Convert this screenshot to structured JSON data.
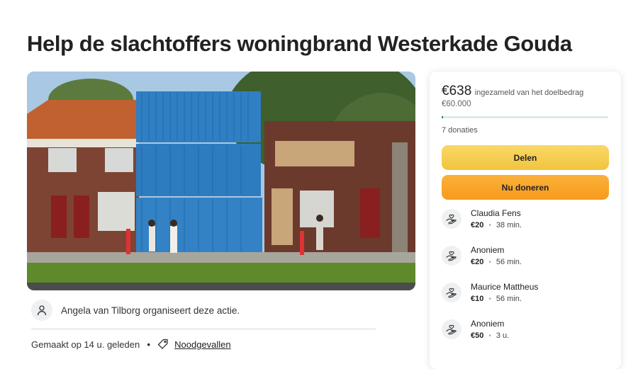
{
  "page": {
    "title": "Help de slachtoffers woningbrand Westerkade Gouda"
  },
  "hero": {
    "image_name": "containers-in-front-of-burned-houses-photo"
  },
  "organizer": {
    "text": "Angela van Tilborg organiseert deze actie.",
    "icon": "person-icon"
  },
  "meta": {
    "created": "Gemaakt op 14 u. geleden",
    "separator": "•",
    "category": "Noodgevallen",
    "category_icon": "tag-icon"
  },
  "fundraiser": {
    "amount": "€638",
    "raised_label": "ingezameld van het doelbedrag",
    "goal": "€60.000",
    "progress_fraction": 0.0106,
    "donations": "7 donaties",
    "share_label": "Delen",
    "donate_label": "Nu doneren",
    "colors": {
      "share": "#f5ce52",
      "donate": "#f9a62b",
      "progress": "#0a7a55"
    }
  },
  "donors": [
    {
      "name": "Claudia Fens",
      "amount": "€20",
      "time": "38 min.",
      "icon": "hand-heart-icon"
    },
    {
      "name": "Anoniem",
      "amount": "€20",
      "time": "56 min.",
      "icon": "hand-heart-icon"
    },
    {
      "name": "Maurice Mattheus",
      "amount": "€10",
      "time": "56 min.",
      "icon": "hand-heart-icon"
    },
    {
      "name": "Anoniem",
      "amount": "€50",
      "time": "3 u.",
      "icon": "hand-heart-icon"
    }
  ]
}
